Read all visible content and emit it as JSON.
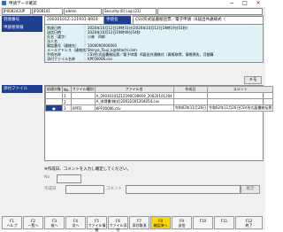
{
  "window": {
    "title": "申請データ確認",
    "minimize": "−",
    "maximize": "□",
    "close": "✕"
  },
  "status": [
    "JP008242UP",
    "JP208141",
    "admin",
    "Security:(0) Log:(21)",
    ""
  ],
  "header": {
    "receipt_label": "到達番号",
    "receipt_value": "20030101Z-121931-8919",
    "procedure_label": "手続名",
    "procedure_value": "CSV形式届書総括票／電子申請（6届出共通様式（"
  },
  "info": {
    "section_label": "申請者情報",
    "rows": [
      {
        "key": "到達日時",
        "value": "：2020年10月12日19時31分(2020年10月12日19時19分51秒)"
      },
      {
        "key": "送信日時",
        "value": "：2020年10月12日19時49分54秒"
      },
      {
        "key": "氏名（漢字）",
        "value": "：小林　四郎"
      },
      {
        "key": "法人名",
        "value": "："
      },
      {
        "key": "電話番号（連絡先）",
        "value": "：1000000000000"
      },
      {
        "key": "メールアドレス（連絡先）",
        "value": "：Shinya_Tsuji_k@hitachi.com"
      },
      {
        "key": "手続名称",
        "value": "：CSV形式届書総括票／電子申請（6届出共通様式（資格取得、資格喪失、月額算"
      },
      {
        "key": "添付ファイル名称",
        "value": "：KPF00006.csv"
      }
    ]
  },
  "memo_button": "メモ",
  "attach": {
    "section_label": "添付ファイル",
    "columns": [
      "処理対象",
      "No.",
      "ファイル種別",
      "ファイル名",
      "作成日",
      "コメント"
    ],
    "rows": [
      {
        "checked": "",
        "no": "1",
        "kind": "",
        "name": "A_20030101Z12190C08919_20020101204",
        "date": "",
        "comment": ""
      },
      {
        "checked": "",
        "no": "2",
        "kind": "",
        "name": "A_申請書(様式)20031001204054.csv",
        "date": "",
        "comment": ""
      },
      {
        "checked": "●",
        "no": "3",
        "kind": "XPFD",
        "name": "KPF00006.csv",
        "date": "令和02年11月26日",
        "comment": "令和02年11月26日CSV形式届書総括票"
      }
    ]
  },
  "note": "※作成日、コメントを入力し確定してください。",
  "form": {
    "no_label": "No.",
    "date_label": "作成日",
    "comment_label": "コメント",
    "confirm_button": "確定"
  },
  "fkeys": [
    {
      "k": "F1",
      "label": "ヘルプ"
    },
    {
      "k": "F2",
      "label": "一覧へ"
    },
    {
      "k": "F3",
      "label": "前へ"
    },
    {
      "k": "F4",
      "label": "次へ"
    },
    {
      "k": "F5",
      "label": "ファイル情報"
    },
    {
      "k": "F6",
      "label": "ファイル添付"
    },
    {
      "k": "F7",
      "label": "添付取消"
    },
    {
      "k": "F8",
      "label": "確認済へ"
    },
    {
      "k": "F9",
      "label": "送信"
    },
    {
      "k": "F10",
      "label": ""
    },
    {
      "k": "F11",
      "label": ""
    },
    {
      "k": "F12",
      "label": "終了"
    }
  ]
}
